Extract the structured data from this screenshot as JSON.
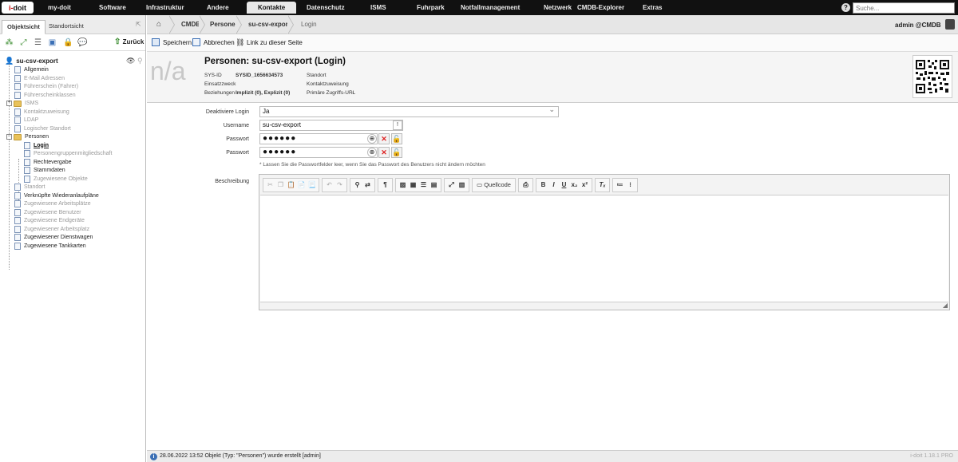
{
  "app": {
    "logo_prefix": "i-",
    "logo_main": "doit",
    "version": "i-doit 1.18.1 PRO"
  },
  "topnav": {
    "items": [
      "my-doit",
      "Software",
      "Infrastruktur",
      "Andere",
      "Kontakte",
      "Datenschutz",
      "ISMS",
      "Fuhrpark",
      "Notfallmanagement",
      "Netzwerk",
      "CMDB-Explorer",
      "Extras"
    ],
    "active": "Kontakte",
    "search_placeholder": "Suche...",
    "help_icon": "?"
  },
  "left": {
    "tabs": [
      "Objektsicht",
      "Standortsicht"
    ],
    "back_label": "Zurück",
    "root_label": "su-csv-export",
    "tree": [
      {
        "label": "Allgemein",
        "style": "dark",
        "type": "doc"
      },
      {
        "label": "E-Mail Adressen",
        "style": "grey",
        "type": "doc"
      },
      {
        "label": "Führerschein (Fahrer)",
        "style": "grey",
        "type": "doc"
      },
      {
        "label": "Führerscheinklassen",
        "style": "grey",
        "type": "doc"
      },
      {
        "label": "ISMS",
        "style": "grey",
        "type": "folder"
      },
      {
        "label": "Kontaktzuweisung",
        "style": "grey",
        "type": "doc"
      },
      {
        "label": "LDAP",
        "style": "grey",
        "type": "doc"
      },
      {
        "label": "Logischer Standort",
        "style": "grey",
        "type": "doc"
      },
      {
        "label": "Personen",
        "style": "dark",
        "type": "folder"
      },
      {
        "label": "Login",
        "style": "selected",
        "type": "doc"
      },
      {
        "label": "Personengruppenmitgliedschaft",
        "style": "grey",
        "type": "doc"
      },
      {
        "label": "Rechtevergabe",
        "style": "dark",
        "type": "doc"
      },
      {
        "label": "Stammdaten",
        "style": "dark",
        "type": "doc"
      },
      {
        "label": "Zugewiesene Objekte",
        "style": "grey",
        "type": "doc"
      },
      {
        "label": "Standort",
        "style": "grey",
        "type": "doc"
      },
      {
        "label": "Verknüpfte Wiederanlaufpläne",
        "style": "dark",
        "type": "doc"
      },
      {
        "label": "Zugewiesene Arbeitsplätze",
        "style": "grey",
        "type": "doc"
      },
      {
        "label": "Zugewiesene Benutzer",
        "style": "grey",
        "type": "doc"
      },
      {
        "label": "Zugewiesene Endgeräte",
        "style": "grey",
        "type": "doc"
      },
      {
        "label": "Zugewiesener Arbeitsplatz",
        "style": "grey",
        "type": "doc"
      },
      {
        "label": "Zugewiesener Dienstwagen",
        "style": "dark",
        "type": "doc"
      },
      {
        "label": "Zugewiesene Tankkarten",
        "style": "dark",
        "type": "doc"
      }
    ]
  },
  "breadcrumb": [
    "CMDB",
    "Personen",
    "su-csv-export",
    "Login"
  ],
  "user": {
    "label": "admin @CMDB"
  },
  "actions": {
    "save": "Speichern",
    "cancel": "Abbrechen",
    "link": "Link zu dieser Seite"
  },
  "header": {
    "image_placeholder": "n/a",
    "title": "Personen: su-csv-export (Login)",
    "sysid_label": "SYS-ID",
    "sysid_value": "SYSID_1656634573",
    "purpose_label": "Einsatzzweck",
    "relations_label": "Beziehungen",
    "relations_value": "Implizit (0), Explizit (0)",
    "location_label": "Standort",
    "contact_label": "Kontaktzuweisung",
    "url_label": "Primäre Zugriffs-URL",
    "url_value": "-"
  },
  "form": {
    "deactivate_label": "Deaktiviere Login",
    "deactivate_value": "Ja",
    "username_label": "Username",
    "username_value": "su-csv-export",
    "password_label": "Passwort",
    "password_value": "●●●●●●",
    "password2_label": "Passwort",
    "password2_value": "●●●●●●",
    "hint": "* Lassen Sie die Passwortfelder leer, wenn Sie das Passwort des Benutzers nicht ändern möchten",
    "description_label": "Beschreibung",
    "source_button": "Quellcode"
  },
  "status": {
    "text": "28.06.2022 13:52 Objekt (Typ: \"Personen\") wurde erstellt [admin]"
  }
}
